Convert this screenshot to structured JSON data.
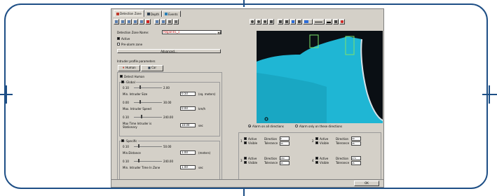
{
  "tabs": [
    {
      "label": "Detection Zone",
      "icon": "detection-zone-icon",
      "color": "#c0392b"
    },
    {
      "label": "Depth",
      "icon": "depth-icon",
      "color": "#2c3e50"
    },
    {
      "label": "Events",
      "icon": "events-icon",
      "color": "#2980b9"
    }
  ],
  "detection_zone": {
    "label": "Detection Zone Name:",
    "value": "Region01_1"
  },
  "active_label": "Active",
  "prealarm_label": "Pre-alarm zone",
  "advanced_label": "Advanced...",
  "intruder_profile_label": "Intruder profile parameters",
  "profile_human": "Human",
  "profile_car": "Car",
  "detect_human_label": "Detect Human",
  "global": {
    "title": "Global",
    "size_min": "0.10",
    "size_max": "2.00",
    "size_value": "0.50",
    "size_label": "Min. Intruder Size",
    "size_unit": "(sq. meters)",
    "speed_min": "0.00",
    "speed_max": "30.00",
    "speed_value": "0.00",
    "speed_label": "Max. Intruder Speed",
    "speed_unit": "km/h",
    "time_min": "0.10",
    "time_max": "240.00",
    "time_value": "10.00",
    "time_label": "Max Time Intruder is Stationary",
    "time_unit": "sec"
  },
  "specific": {
    "title": "Specific",
    "dist_min": "0.10",
    "dist_max": "50.00",
    "dist_value": "1.00",
    "dist_label": "Min.Distance",
    "dist_unit": "(meters)",
    "zone_min": "0.10",
    "zone_max": "240.00",
    "zone_value": "1.00",
    "zone_label": "Min. Intruder Time In Zone",
    "zone_unit": "sec"
  },
  "alarm_all_label": "Alarm on all directions",
  "alarm_these_label": "Alarm only on these directions",
  "directions": [
    {
      "active": "Active",
      "visible": "Visible",
      "dir_label": "Direction",
      "tol_label": "Tolerance",
      "dir_val": "0",
      "tol_val": "45"
    },
    {
      "active": "Active",
      "visible": "Visible",
      "dir_label": "Direction",
      "tol_label": "Tolerance",
      "dir_val": "90",
      "tol_val": "45"
    },
    {
      "active": "Active",
      "visible": "Visible",
      "dir_label": "Direction",
      "tol_label": "Tolerance",
      "dir_val": "180",
      "tol_val": "45"
    },
    {
      "active": "Active",
      "visible": "Visible",
      "dir_label": "Direction",
      "tol_label": "Tolerance",
      "dir_val": "270",
      "tol_val": "45"
    }
  ],
  "ok_label": "OK",
  "colors": {
    "frame": "#1e4f86",
    "water": "#1fb6d4",
    "zone": "#7fe36a"
  }
}
